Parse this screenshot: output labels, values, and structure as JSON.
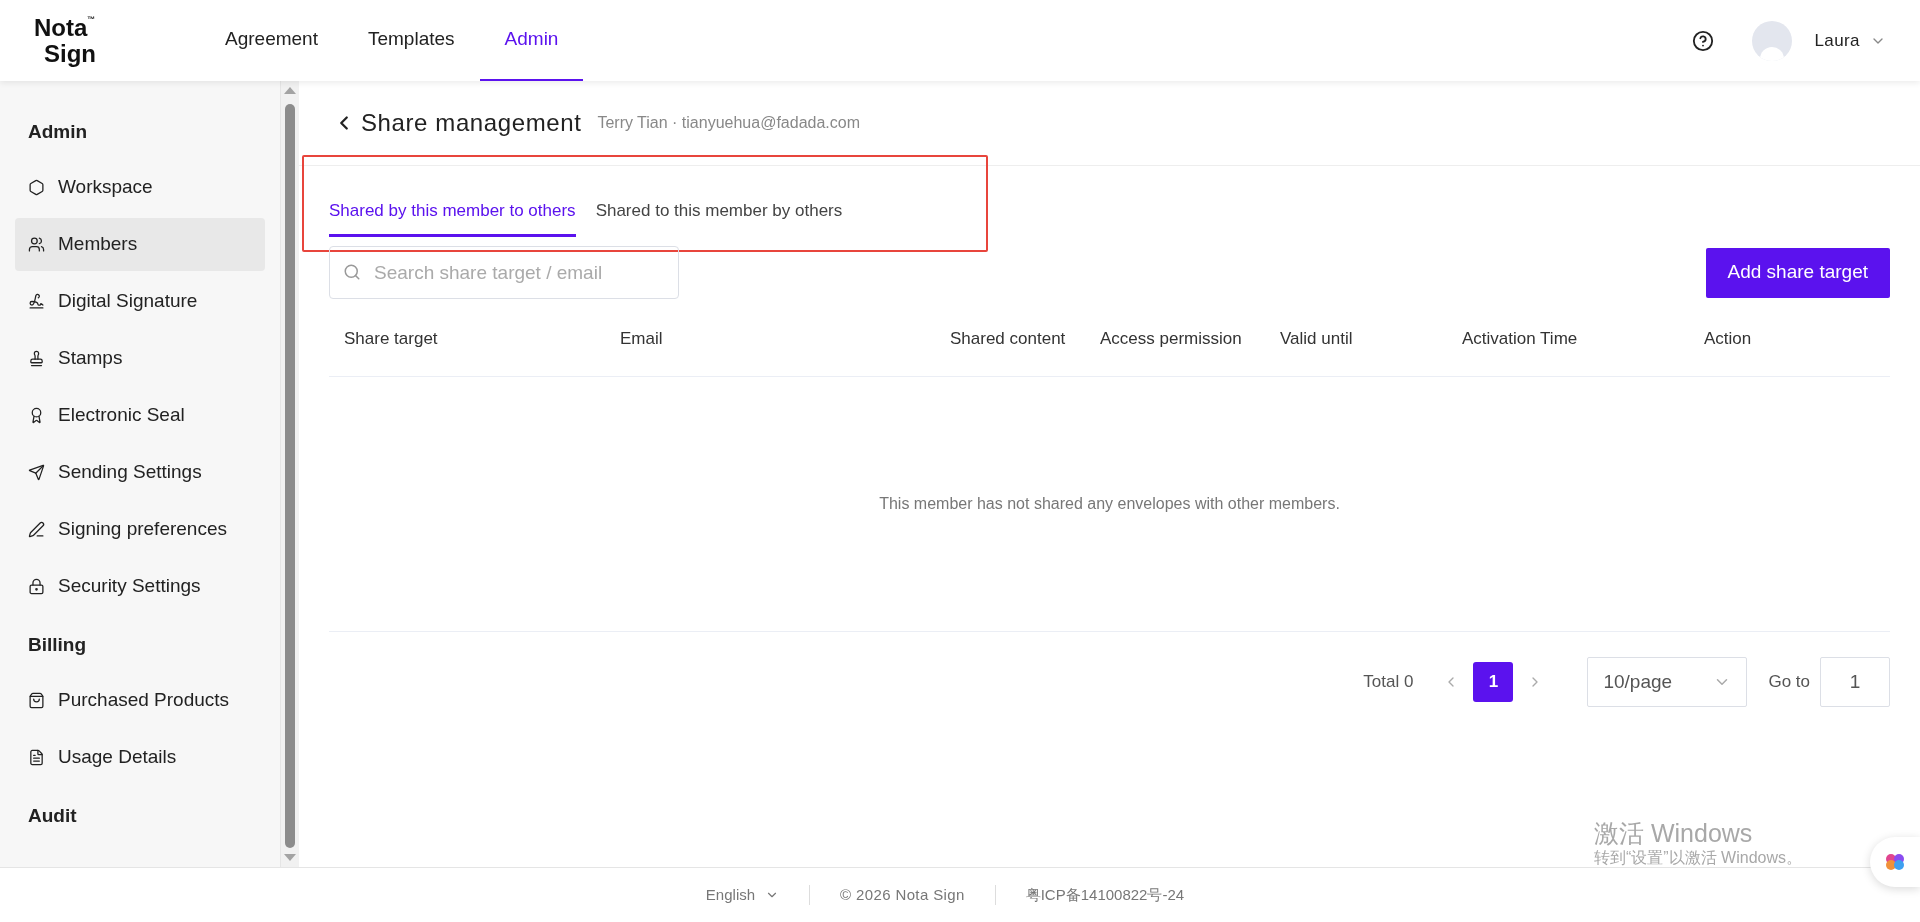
{
  "header": {
    "logo_top": "Nota",
    "logo_bottom": "Sign",
    "logo_tm": "™",
    "nav": [
      {
        "label": "Agreement",
        "selected": false
      },
      {
        "label": "Templates",
        "selected": false
      },
      {
        "label": "Admin",
        "selected": true
      }
    ],
    "user": "Laura"
  },
  "sidebar": {
    "sections": [
      {
        "title": "Admin",
        "items": [
          {
            "label": "Workspace",
            "selected": false
          },
          {
            "label": "Members",
            "selected": true
          },
          {
            "label": "Digital Signature",
            "selected": false
          },
          {
            "label": "Stamps",
            "selected": false
          },
          {
            "label": "Electronic Seal",
            "selected": false
          },
          {
            "label": "Sending Settings",
            "selected": false
          },
          {
            "label": "Signing preferences",
            "selected": false
          },
          {
            "label": "Security Settings",
            "selected": false
          }
        ]
      },
      {
        "title": "Billing",
        "items": [
          {
            "label": "Purchased Products",
            "selected": false
          },
          {
            "label": "Usage Details",
            "selected": false
          }
        ]
      },
      {
        "title": "Audit"
      }
    ]
  },
  "page": {
    "title": "Share management",
    "subtitle": "Terry Tian · tianyuehua@fadada.com",
    "tabs": [
      {
        "label": "Shared by this member to others",
        "selected": true
      },
      {
        "label": "Shared to this member by others",
        "selected": false
      }
    ],
    "search": {
      "placeholder": "Search share target / email"
    },
    "add_button": "Add share target",
    "table": {
      "columns": [
        "Share target",
        "Email",
        "Shared content",
        "Access permission",
        "Valid until",
        "Activation Time",
        "Action"
      ],
      "empty_text": "This member has not shared any envelopes with other members."
    },
    "pagination": {
      "total": "Total 0",
      "pages": [
        {
          "label": "1",
          "selected": true
        }
      ],
      "page_size": "10/page",
      "goto_label": "Go to",
      "goto_value": "1"
    }
  },
  "footer": {
    "language": "English",
    "copyright": "© 2026 Nota Sign",
    "icp": "粤ICP备14100822号-24"
  },
  "activation_notice": {
    "title": "激活 Windows",
    "text": "转到“设置”以激活 Windows。"
  }
}
